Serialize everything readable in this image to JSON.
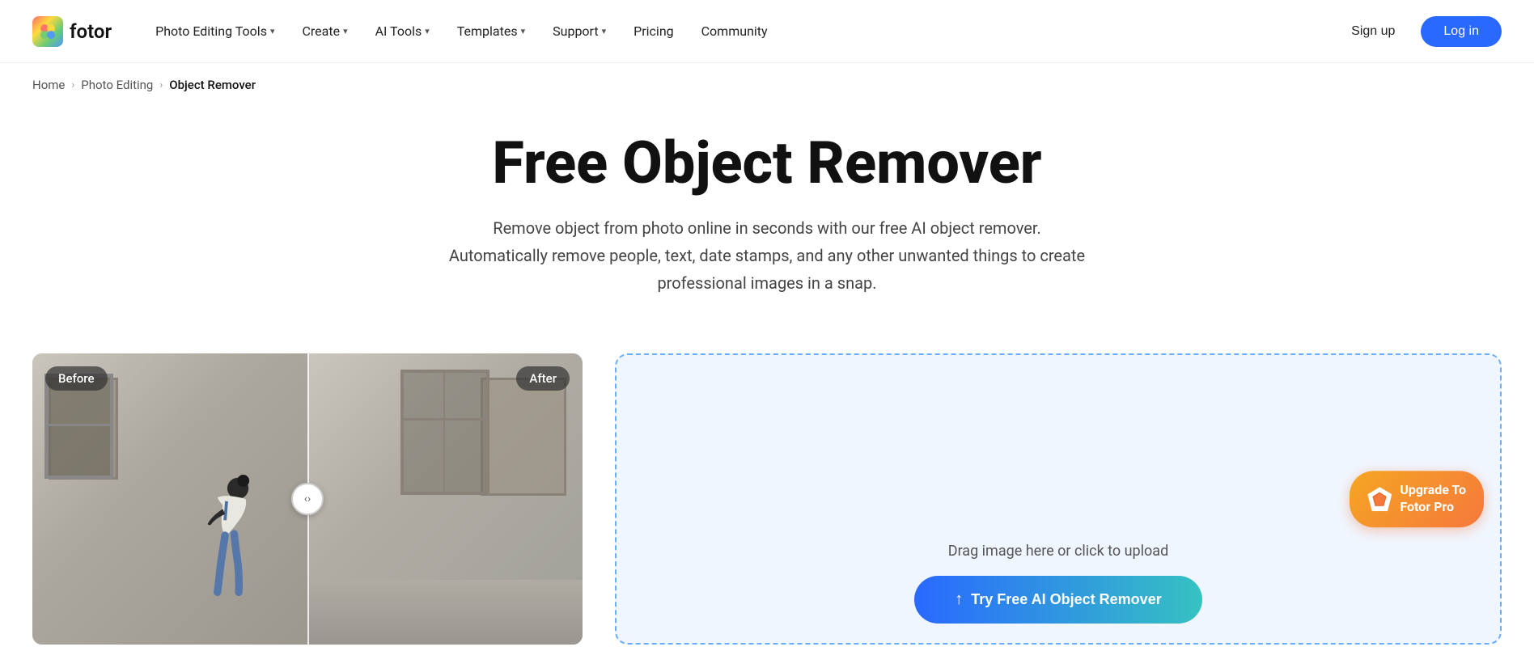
{
  "header": {
    "logo_text": "fotor",
    "nav_items": [
      {
        "label": "Photo Editing Tools",
        "has_dropdown": true,
        "id": "photo-editing-tools"
      },
      {
        "label": "Create",
        "has_dropdown": true,
        "id": "create"
      },
      {
        "label": "AI Tools",
        "has_dropdown": true,
        "id": "ai-tools"
      },
      {
        "label": "Templates",
        "has_dropdown": true,
        "id": "templates"
      },
      {
        "label": "Support",
        "has_dropdown": true,
        "id": "support"
      },
      {
        "label": "Pricing",
        "has_dropdown": false,
        "id": "pricing"
      },
      {
        "label": "Community",
        "has_dropdown": false,
        "id": "community"
      }
    ],
    "signup_label": "Sign up",
    "login_label": "Log in"
  },
  "breadcrumb": {
    "home": "Home",
    "parent": "Photo Editing",
    "current": "Object Remover"
  },
  "hero": {
    "title": "Free Object Remover",
    "description": "Remove object from photo online in seconds with our free AI object remover. Automatically remove people, text, date stamps, and any other unwanted things to create professional images in a snap."
  },
  "before_after": {
    "before_label": "Before",
    "after_label": "After"
  },
  "upload_panel": {
    "drag_text": "Drag image here or click to upload",
    "try_button_label": "Try Free AI Object Remover",
    "upload_icon": "↑"
  },
  "upgrade_badge": {
    "label_line1": "Upgrade To",
    "label_line2": "Fotor Pro"
  }
}
